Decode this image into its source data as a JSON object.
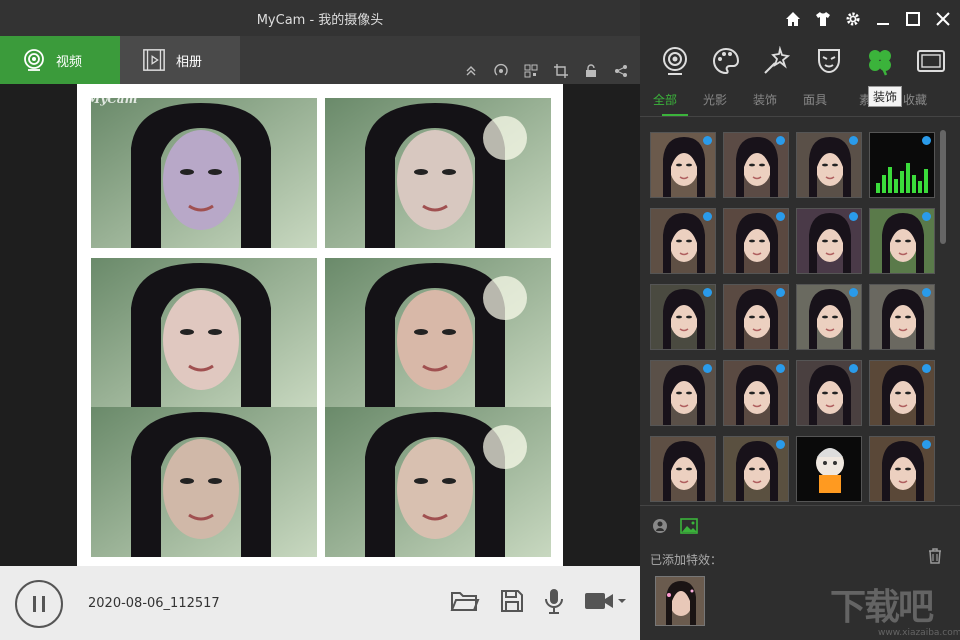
{
  "window": {
    "title": "MyCam - 我的摄像头"
  },
  "tabs": {
    "video_label": "视频",
    "album_label": "相册"
  },
  "toolbar_icons": [
    "collapse-up-icon",
    "broadcast-icon",
    "qr-code-icon",
    "crop-icon",
    "unlock-icon",
    "share-icon"
  ],
  "preview": {
    "watermark": "MyCam",
    "cells": [
      {
        "name": "face-effect-cat",
        "tint": "#b8a8c8"
      },
      {
        "name": "face-effect-sparkle",
        "tint": "#d8c8c0"
      },
      {
        "name": "face-effect-makeup",
        "tint": "#e0c8c0"
      },
      {
        "name": "face-effect-glow",
        "tint": "#d8b8a8"
      },
      {
        "name": "face-effect-swap",
        "tint": "#d0b8a8"
      },
      {
        "name": "face-effect-stars",
        "tint": "#d8c0b0"
      }
    ]
  },
  "bottombar": {
    "timestamp": "2020-08-06_112517",
    "icons": [
      "folder-open-icon",
      "save-icon",
      "microphone-icon",
      "video-camera-icon"
    ]
  },
  "window_controls": [
    "home-icon",
    "skin-icon",
    "settings-icon",
    "minimize-icon",
    "maximize-icon",
    "close-icon"
  ],
  "categories": [
    {
      "name": "webcam-category-icon"
    },
    {
      "name": "palette-category-icon"
    },
    {
      "name": "magic-wand-category-icon"
    },
    {
      "name": "mask-category-icon"
    },
    {
      "name": "clover-category-icon",
      "active": true
    },
    {
      "name": "frame-category-icon"
    }
  ],
  "tooltip": "装饰",
  "subtabs": [
    {
      "label": "全部",
      "active": true
    },
    {
      "label": "光影"
    },
    {
      "label": "装饰"
    },
    {
      "label": "面具"
    },
    {
      "label": "素"
    },
    {
      "label": "收藏"
    }
  ],
  "effects_grid": {
    "rows": 5,
    "cols": 4,
    "items": [
      {
        "dot": true,
        "bg": "#6b5a4c"
      },
      {
        "dot": true,
        "bg": "#5b4b45"
      },
      {
        "dot": true,
        "bg": "#5a5048"
      },
      {
        "dot": true,
        "bg": "#0c0c0c",
        "equalizer": true
      },
      {
        "dot": true,
        "bg": "#5e4f44"
      },
      {
        "dot": true,
        "bg": "#5a4840"
      },
      {
        "dot": true,
        "bg": "#4a3a48"
      },
      {
        "dot": true,
        "bg": "#5a7a4a"
      },
      {
        "dot": true,
        "bg": "#4a4a40"
      },
      {
        "dot": true,
        "bg": "#5a4a42"
      },
      {
        "dot": true,
        "bg": "#6a6a60"
      },
      {
        "dot": true,
        "bg": "#6a6860"
      },
      {
        "dot": true,
        "bg": "#5a5048"
      },
      {
        "dot": true,
        "bg": "#5a4a42"
      },
      {
        "dot": true,
        "bg": "#4a4040"
      },
      {
        "dot": true,
        "bg": "#5a4838"
      },
      {
        "dot": false,
        "bg": "#5e4f44"
      },
      {
        "dot": true,
        "bg": "#5a5040"
      },
      {
        "dot": false,
        "bg": "#0a0a0a",
        "cartoon": true
      },
      {
        "dot": true,
        "bg": "#5a4838"
      }
    ]
  },
  "added": {
    "mode_icons": [
      "face-mode-icon",
      "image-mode-icon"
    ],
    "label": "已添加特效：",
    "trash_icon": "trash-icon"
  },
  "brand": {
    "mark": "下载吧",
    "url": "www.xiazaiba.com"
  }
}
